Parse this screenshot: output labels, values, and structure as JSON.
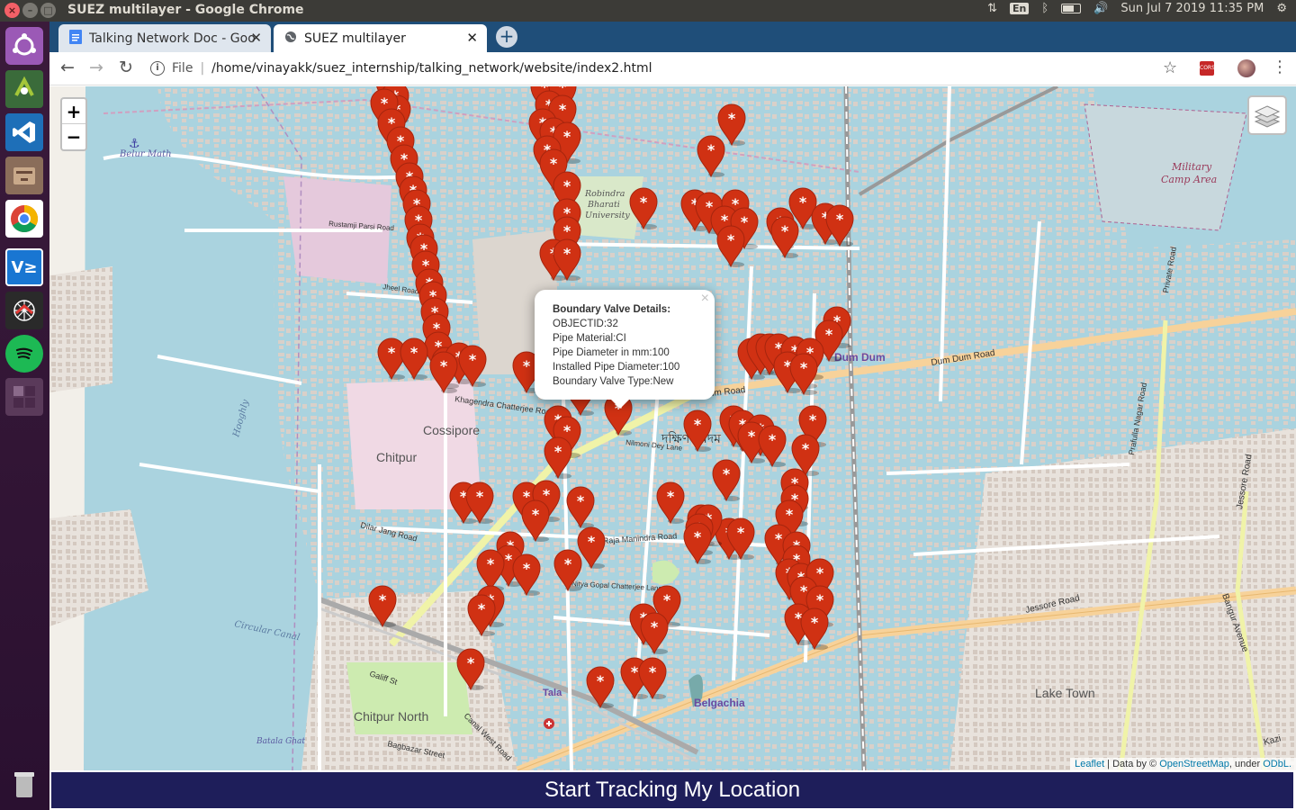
{
  "window": {
    "title": "SUEZ multilayer - Google Chrome"
  },
  "tray": {
    "datetime": "Sun Jul  7 2019 11:35 PM",
    "lang": "En"
  },
  "launcher": {
    "apps": [
      "ubuntu-dash",
      "android-studio",
      "vscode",
      "files",
      "chrome",
      "vnc-viewer",
      "network-app",
      "spotify",
      "workspaces",
      "trash"
    ]
  },
  "tabs": [
    {
      "label": "Talking Network Doc - Goo",
      "icon": "docs-icon"
    },
    {
      "label": "SUEZ multilayer",
      "icon": "globe-icon"
    }
  ],
  "toolbar": {
    "file_label": "File",
    "url": "/home/vinayakk/suez_internship/talking_network/website/index2.html",
    "ext_label": "CORS"
  },
  "map": {
    "zoom_in": "+",
    "zoom_out": "−",
    "labels": {
      "belur": "Belur Math",
      "rabindra": "Rabindra Bharati University",
      "military": "Military Camp Area",
      "cossipore": "Cossipore",
      "chitpur": "Chitpur",
      "hooghly": "Hooghly",
      "circular": "Circular Canal",
      "chitpur_north": "Chitpur North",
      "tala": "Tala",
      "belgachia": "Belgachia",
      "lake_town": "Lake Town",
      "dumdum": "Dum Dum",
      "dumdum_road": "Dum Dum Road",
      "jessore_road": "Jessore Road",
      "baguiati": "Bangur Avenue",
      "private_road": "Private Road",
      "raja": "Raja Manindra Road",
      "dilar": "Dilar Jang Road",
      "khagendra": "Khagendra Chatterjee Road",
      "rustamji": "Rustamji Parsi Road",
      "jheel": "Jheel Road",
      "nilmoni": "Nilmoni Dey Lane",
      "nityagopal": "Nitya Gopal Chatterjee Lane",
      "galiff": "Galiff St",
      "canal_west": "Canal West Road",
      "bagbazar": "Bagbazar Street",
      "batala": "Batala Ghat",
      "bengali": "দক্ষিণ দমদম",
      "prafulla": "Prafulla Nagar Road",
      "kazi": "Kazi"
    },
    "popup": {
      "title": "Boundary Valve Details:",
      "lines": [
        "OBJECTID:32",
        "Pipe Material:CI",
        "Pipe Diameter in mm:100",
        "Installed Pipe Diameter:100",
        "Boundary Valve Type:New"
      ]
    },
    "attribution": {
      "leaflet": "Leaflet",
      "sep1": " | Data by © ",
      "osm": "OpenStreetMap",
      "sep2": ", under ",
      "odbl": "ODbL."
    },
    "marker_color": "#d03113"
  },
  "track_button": "Start Tracking My Location"
}
